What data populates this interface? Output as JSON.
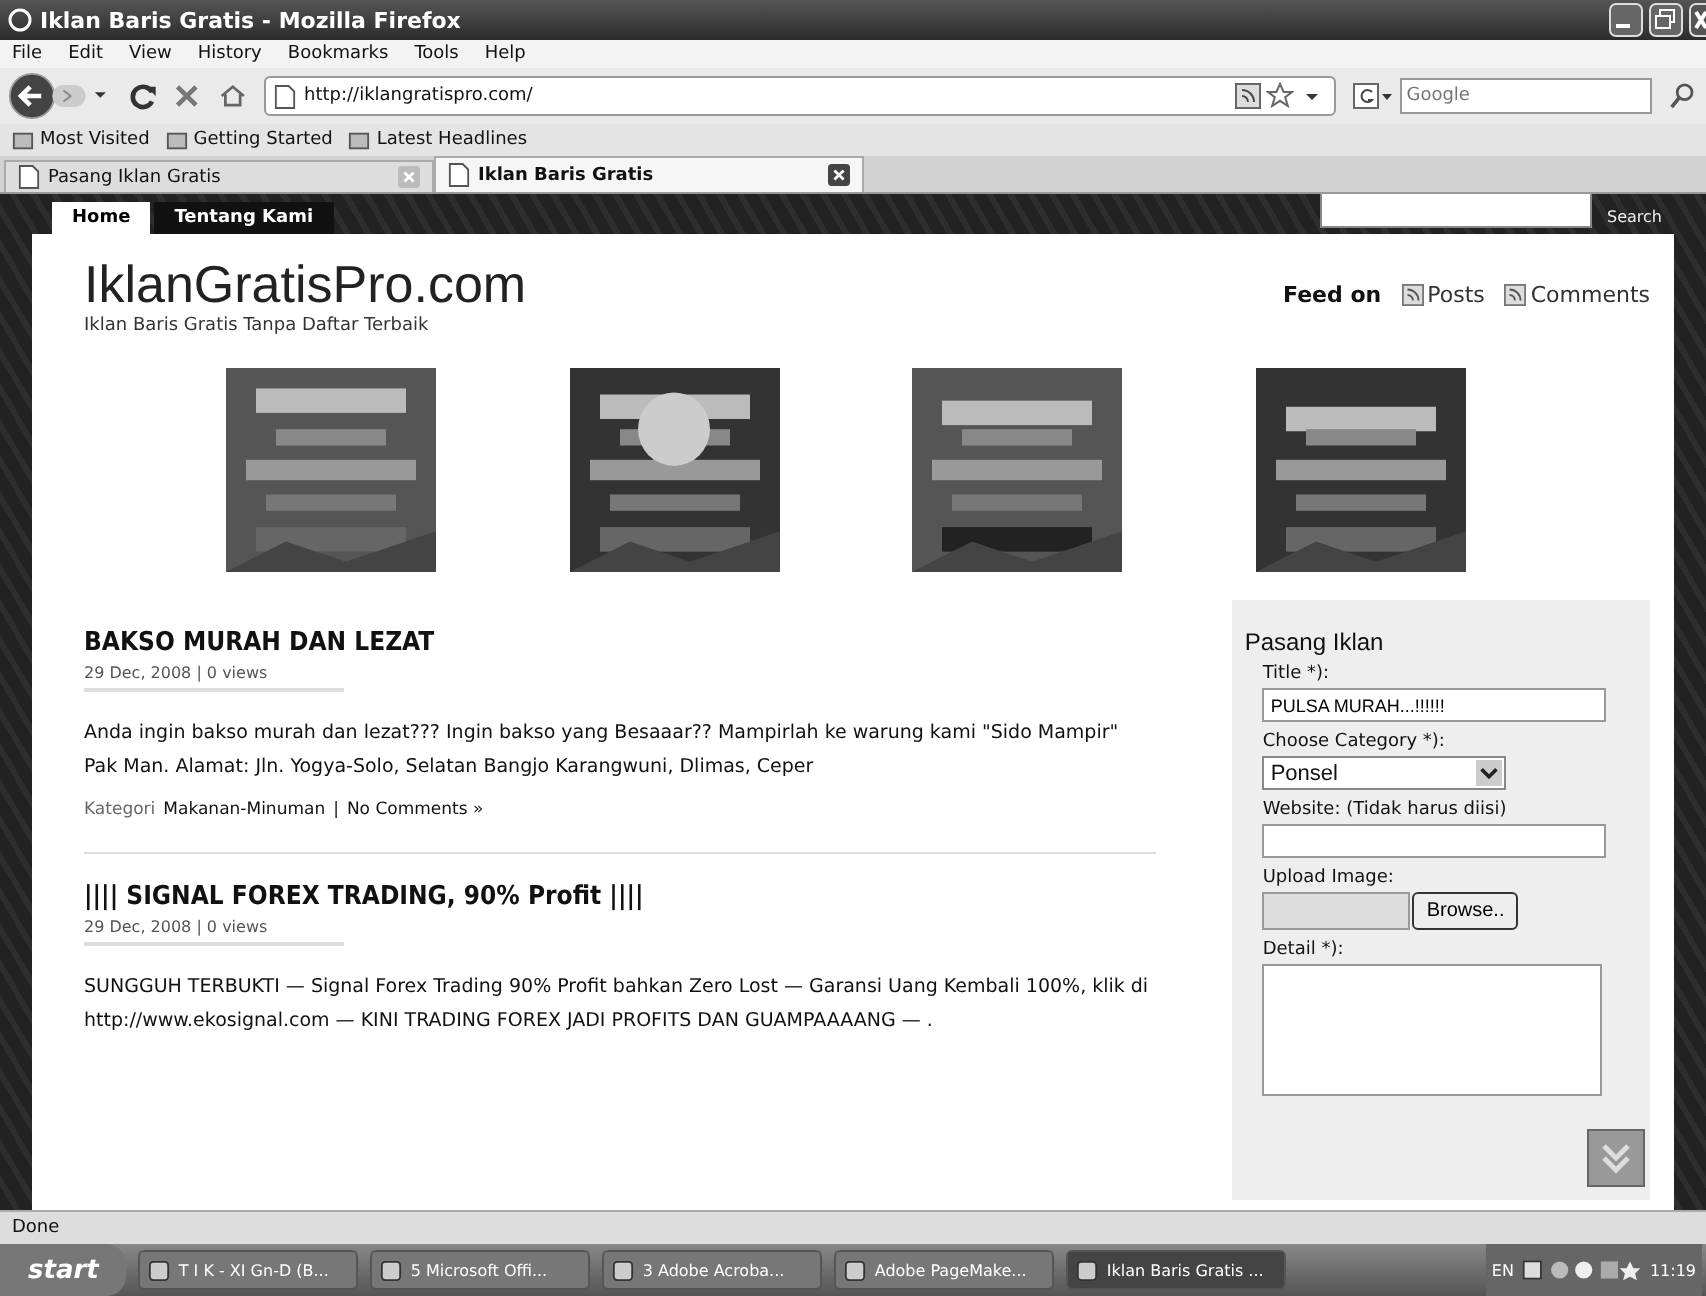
{
  "window": {
    "title": "Iklan Baris Gratis - Mozilla Firefox"
  },
  "menu": [
    "File",
    "Edit",
    "View",
    "History",
    "Bookmarks",
    "Tools",
    "Help"
  ],
  "toolbar": {
    "url": "http://iklangratispro.com/",
    "search_placeholder": "Google"
  },
  "bookmarks": [
    "Most Visited",
    "Getting Started",
    "Latest Headlines"
  ],
  "tabs": [
    {
      "label": "Pasang Iklan Gratis",
      "selected": false
    },
    {
      "label": "Iklan Baris Gratis",
      "selected": true
    }
  ],
  "page": {
    "nav": [
      {
        "label": "Home",
        "selected": true
      },
      {
        "label": "Tentang Kami",
        "selected": false
      }
    ],
    "search_button": "Search",
    "site_title": "IklanGratisPro.com",
    "tagline": "Iklan Baris Gratis Tanpa Daftar Terbaik",
    "feed_label": "Feed on",
    "feed_links": [
      "Posts",
      "Comments"
    ],
    "banners": [
      {
        "kind": "picture"
      },
      {
        "kind": "picture"
      },
      {
        "kind": "picture"
      },
      {
        "kind": "picture"
      }
    ],
    "posts": [
      {
        "title": "BAKSO MURAH DAN LEZAT",
        "meta": "29 Dec, 2008 | 0 views",
        "body": "Anda ingin bakso murah dan lezat??? Ingin bakso yang Besaaar?? Mampirlah ke warung kami \"Sido Mampir\" Pak Man. Alamat: Jln. Yogya-Solo, Selatan Bangjo Karangwuni, Dlimas, Ceper",
        "category_label": "Kategori",
        "category": "Makanan-Minuman",
        "separator": "|",
        "comments": "No Comments »"
      },
      {
        "title": "|||| SIGNAL FOREX TRADING, 90% Profit ||||",
        "meta": "29 Dec, 2008 | 0 views",
        "body": "SUNGGUH TERBUKTI — Signal Forex Trading 90% Profit bahkan Zero Lost — Garansi Uang Kembali 100%, klik di http://www.ekosignal.com — KINI TRADING FOREX JADI PROFITS DAN GUAMPAAAANG — ."
      }
    ],
    "widget": {
      "title": "Pasang Iklan",
      "fields": [
        {
          "kind": "text",
          "label": "Title *):",
          "value": "PULSA MURAH...!!!!!!"
        },
        {
          "kind": "select",
          "label": "Choose Category *):",
          "value": "Ponsel"
        },
        {
          "kind": "text",
          "label": "Website: (Tidak harus diisi)"
        },
        {
          "kind": "file",
          "label": "Upload Image:",
          "button": "Browse.."
        },
        {
          "kind": "textarea",
          "label": "Detail *):"
        }
      ]
    }
  },
  "status_bar": "Done",
  "taskbar": {
    "start": "start",
    "items": [
      {
        "label": "T I K - XI  Gn-D (B...",
        "selected": false
      },
      {
        "label": "5 Microsoft Offi...",
        "selected": false
      },
      {
        "label": "3 Adobe Acroba...",
        "selected": false
      },
      {
        "label": "Adobe PageMake...",
        "selected": false
      },
      {
        "label": "Iklan Baris Gratis ...",
        "selected": true
      }
    ],
    "lang": "EN",
    "time": "11:19"
  }
}
